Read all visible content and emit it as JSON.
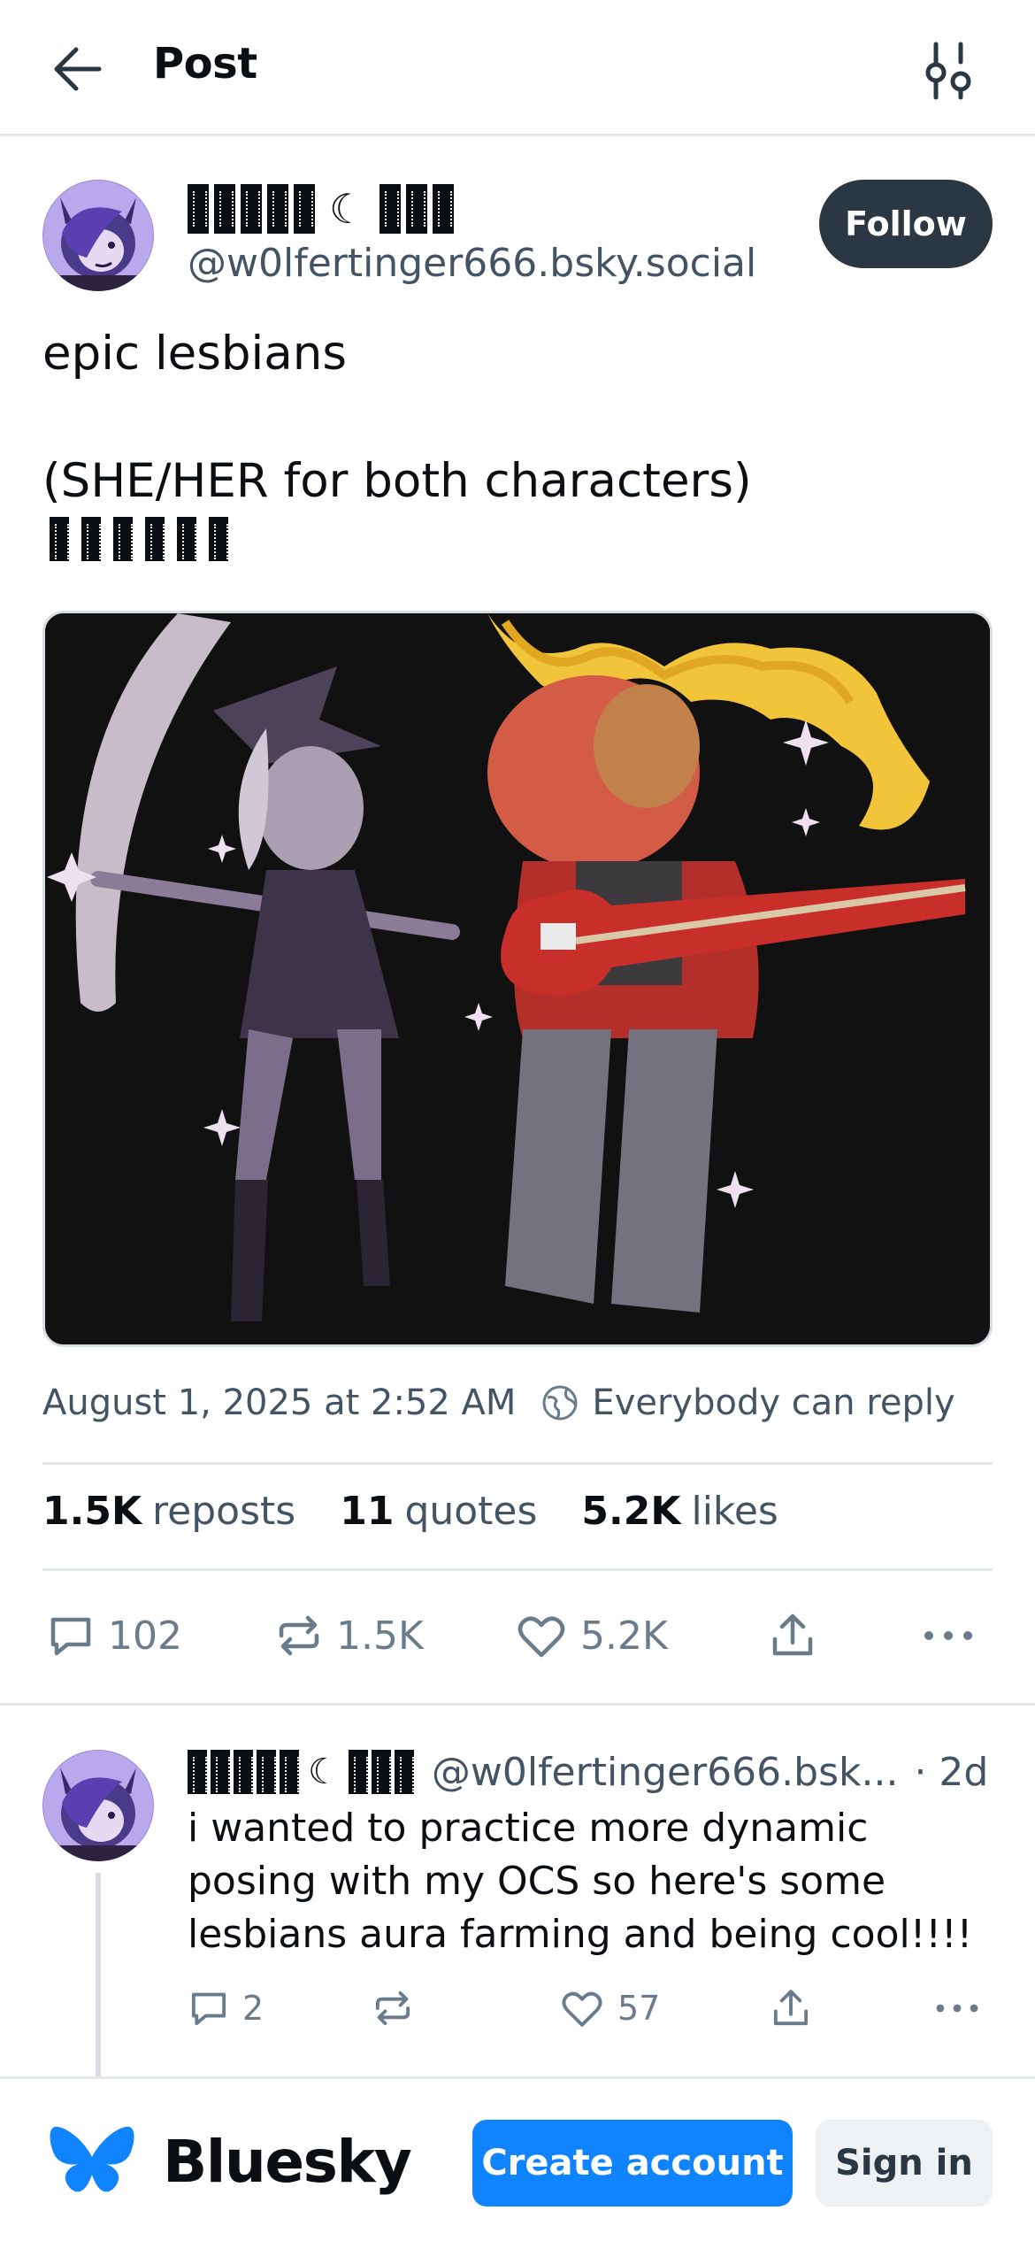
{
  "header": {
    "title": "Post"
  },
  "post": {
    "author_display_name_glyphs": "▯▯▯▯▯ ☾ ▯▯▯",
    "author_name_moon": "☾",
    "author_handle": "@w0lfertinger666.bsky.social",
    "follow_label": "Follow",
    "text": "epic lesbians\n\n(SHE/HER for both characters)",
    "timestamp": "August 1, 2025 at 2:52 AM",
    "reply_setting": "Everybody can reply",
    "stats": {
      "reposts_count": "1.5K",
      "reposts_label": "reposts",
      "quotes_count": "11",
      "quotes_label": "quotes",
      "likes_count": "5.2K",
      "likes_label": "likes"
    },
    "actions": {
      "reply_count": "102",
      "repost_count": "1.5K",
      "like_count": "5.2K"
    }
  },
  "reply": {
    "author_name_moon": "☾",
    "author_handle": "@w0lfertinger666.bsk...",
    "time": "· 2d",
    "text": "i wanted to practice more dynamic posing with my OCS so here's some lesbians aura farming and being cool!!!!",
    "reply_count": "2",
    "like_count": "57"
  },
  "footer": {
    "brand": "Bluesky",
    "create_account_label": "Create account",
    "sign_in_label": "Sign in"
  },
  "colors": {
    "accent": "#1083fe",
    "follow_bg": "#2b3743",
    "muted_text": "#445464"
  },
  "icons": [
    "back-arrow-icon",
    "filter-sliders-icon",
    "globe-icon",
    "reply-icon",
    "repost-icon",
    "like-heart-icon",
    "share-icon",
    "more-options-icon",
    "bluesky-butterfly-icon"
  ]
}
